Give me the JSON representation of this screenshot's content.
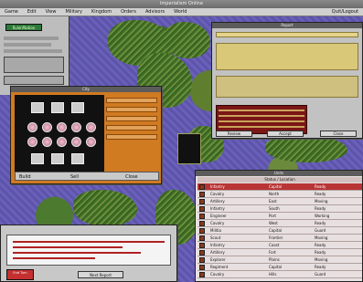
{
  "app": {
    "title": "Imperialism Online"
  },
  "menu": {
    "items": [
      "Game",
      "Edit",
      "View",
      "Military",
      "Kingdom",
      "Orders",
      "Advisors",
      "World"
    ],
    "right": "Quit/Logout"
  },
  "left_panel": {
    "badge": "Ruler/Nation"
  },
  "city_window": {
    "title": "City",
    "footer_buttons": [
      "Build",
      "Sell",
      "Close"
    ]
  },
  "report_window": {
    "title": "Report",
    "buttons": [
      "Review",
      "Accept",
      "Close"
    ]
  },
  "units_window": {
    "title": "Units",
    "subtitle": "Status / Location",
    "rows": [
      {
        "name": "Infantry",
        "loc": "Capital",
        "status": "Ready"
      },
      {
        "name": "Cavalry",
        "loc": "North",
        "status": "Ready"
      },
      {
        "name": "Artillery",
        "loc": "East",
        "status": "Moving"
      },
      {
        "name": "Infantry",
        "loc": "South",
        "status": "Ready"
      },
      {
        "name": "Engineer",
        "loc": "Port",
        "status": "Working"
      },
      {
        "name": "Cavalry",
        "loc": "West",
        "status": "Ready"
      },
      {
        "name": "Militia",
        "loc": "Capital",
        "status": "Guard"
      },
      {
        "name": "Scout",
        "loc": "Frontier",
        "status": "Moving"
      },
      {
        "name": "Infantry",
        "loc": "Coast",
        "status": "Ready"
      },
      {
        "name": "Artillery",
        "loc": "Fort",
        "status": "Ready"
      },
      {
        "name": "Explorer",
        "loc": "Plains",
        "status": "Moving"
      },
      {
        "name": "Regiment",
        "loc": "Capital",
        "status": "Ready"
      },
      {
        "name": "Cavalry",
        "loc": "Hills",
        "status": "Guard"
      }
    ]
  },
  "messages_window": {
    "red_button": "End Turn",
    "button": "Next Report"
  },
  "colors": {
    "ocean": "#5c54a8",
    "land": "#4d7a2a",
    "city_bg": "#d07a22",
    "selected_row": "#b93434"
  }
}
